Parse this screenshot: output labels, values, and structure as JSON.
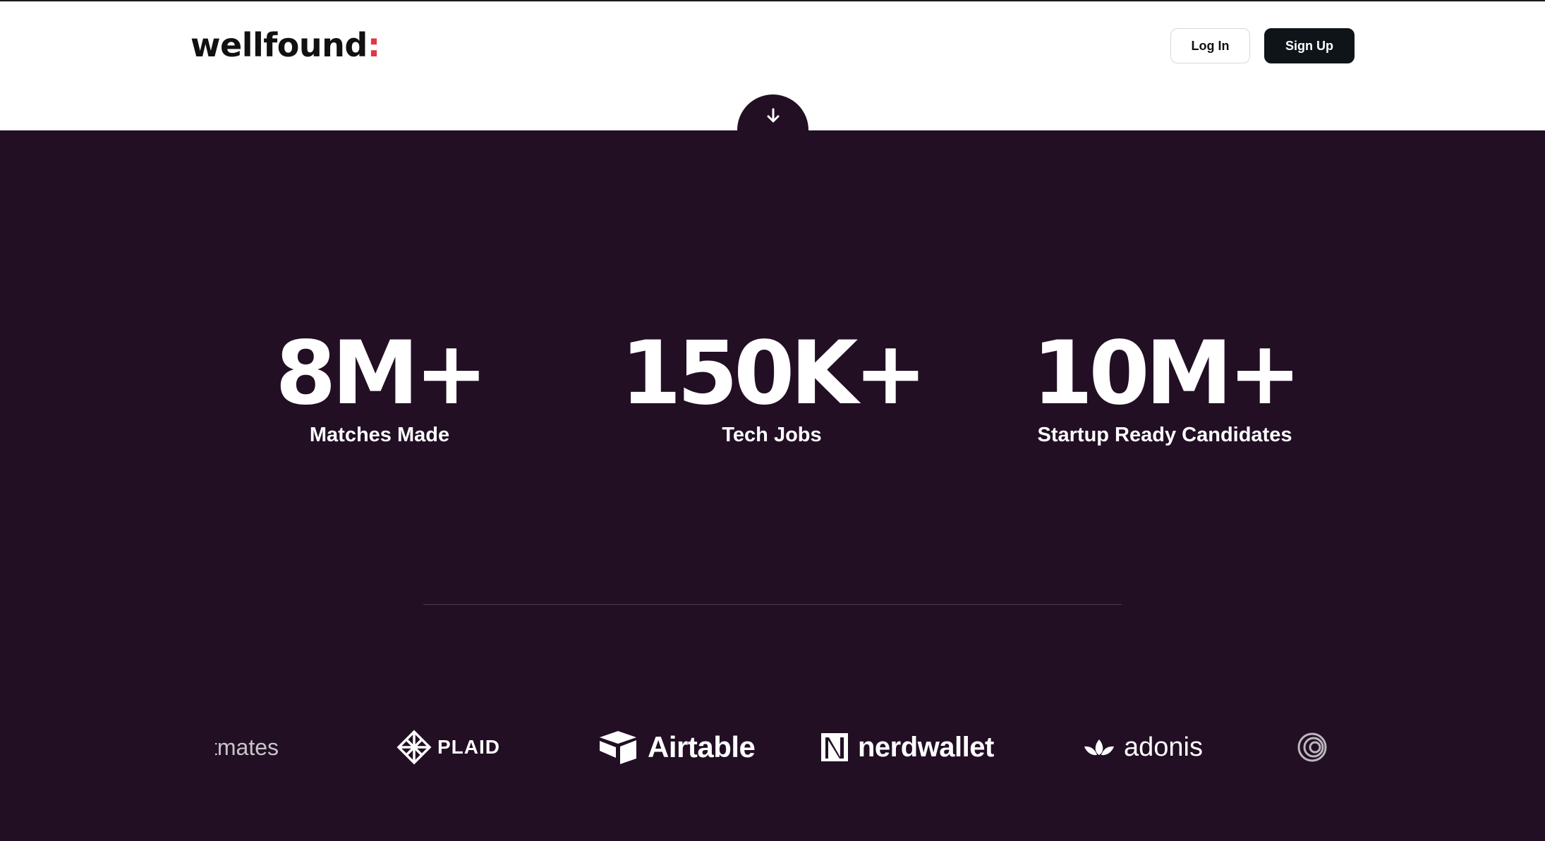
{
  "header": {
    "logo_text": "wellfound",
    "logo_colon": ":",
    "login_label": "Log In",
    "signup_label": "Sign Up"
  },
  "scroll_icon": "arrow-down-icon",
  "stats": [
    {
      "value": "8M+",
      "label": "Matches Made"
    },
    {
      "value": "150K+",
      "label": "Tech Jobs"
    },
    {
      "value": "10M+",
      "label": "Startup Ready Candidates"
    }
  ],
  "companies": [
    {
      "name": "stmates",
      "icon": "none"
    },
    {
      "name": "PLAID",
      "icon": "plaid-logo-icon"
    },
    {
      "name": "Airtable",
      "icon": "airtable-logo-icon"
    },
    {
      "name": "nerdwallet",
      "icon": "nerdwallet-logo-icon"
    },
    {
      "name": "adonis",
      "icon": "adonis-logo-icon"
    },
    {
      "name": "",
      "icon": "swirl-logo-icon"
    }
  ],
  "colors": {
    "brand_dark": "#220f24",
    "logo_accent": "#e0374a",
    "signup_bg": "#0f1418",
    "text_light": "#ffffff"
  }
}
